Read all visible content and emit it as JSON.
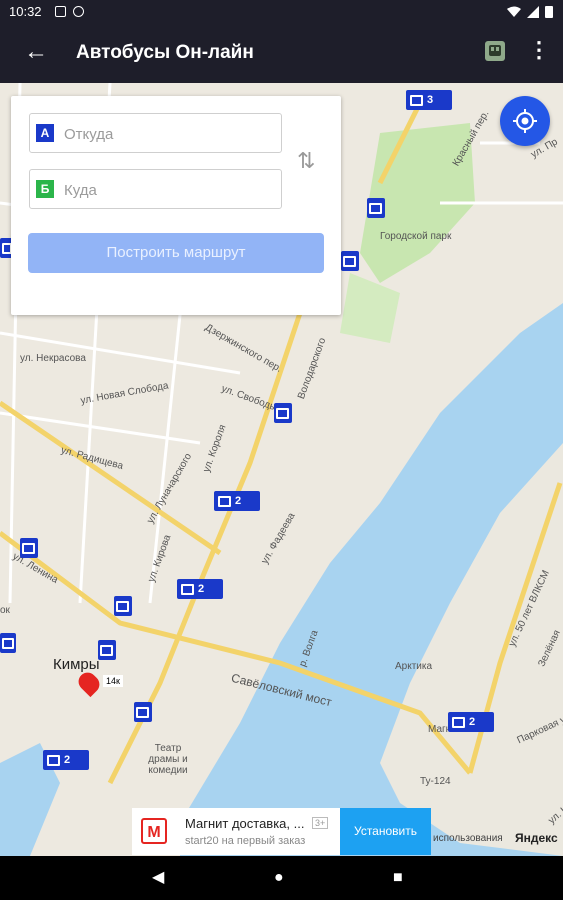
{
  "status_bar": {
    "time": "10:32"
  },
  "app_bar": {
    "title": "Автобусы Он-лайн",
    "back_icon": "arrow-left-icon",
    "bus_icon": "bus-icon",
    "menu_icon": "more-vert-icon"
  },
  "route_form": {
    "from_badge": "А",
    "from_placeholder": "Откуда",
    "to_badge": "Б",
    "to_placeholder": "Куда",
    "route_button": "Построить маршрут"
  },
  "map": {
    "labels": {
      "park": "Городской парк",
      "city": "Кимры",
      "volga": "р. Волга",
      "savelovsky": "Савёловский мост",
      "arctic": "Арктика",
      "theater": "Театр драмы и комедии",
      "magnit": "Магнит",
      "tu124": "Ту-124",
      "krasny": "Красный пер.",
      "upr": "ул. Пр",
      "radishcheva": "ул. Радищева",
      "lenina": "ул. Ленина",
      "kirova": "ул. Кирова",
      "kirova2": "ул. Кирова",
      "korolya": "ул. Короля",
      "svobody": "ул. Свободы",
      "volodarskogo": "Володарского",
      "fadeeva": "ул. Фадеева",
      "lunacharskogo": "ул. Луначарского",
      "nekrasova": "ул. Некрасова",
      "novaya": "ул. Новая Слобода",
      "dzerzh": "Дзержинского пер.",
      "pyatidesyat": "ул. 50 лет ВЛКСМ",
      "zelenaya": "Зелёная",
      "parkovaya": "Парковая ул.",
      "kulik": "ул. Кулик",
      "ok": "ок",
      "fourteen": "14к"
    },
    "bus_counts": {
      "m1": "3",
      "m2": "2",
      "m3": "2",
      "m4": "2",
      "m5": "2"
    }
  },
  "ad": {
    "brand_letter": "М",
    "title": "Магнит доставка, ...",
    "subtitle": "start20 на первый заказ",
    "age_tag": "3+",
    "install_button": "Установить"
  },
  "map_footer": {
    "terms": "использования",
    "provider": "Яндекс"
  },
  "colors": {
    "app_bar": "#1e1e2a",
    "bus_marker": "#1a39c9",
    "locate_button": "#2457e6",
    "route_button": "#92b4f6",
    "water": "#a8d3f0",
    "park": "#c8e6b0",
    "install": "#1da1f2"
  }
}
